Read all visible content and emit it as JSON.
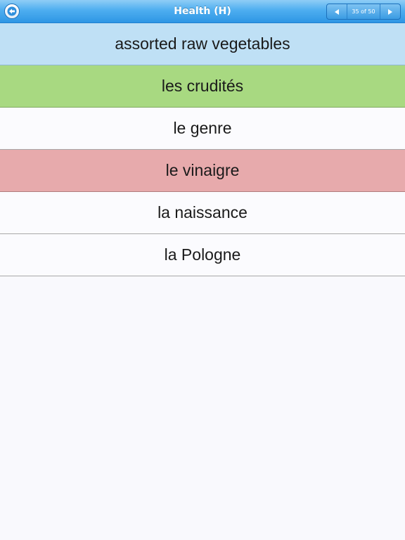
{
  "navbar": {
    "title": "Health (H)",
    "back_icon": "back-arrow-icon",
    "pager": {
      "count": "35 of 50",
      "prev_icon": "triangle-left-icon",
      "next_icon": "triangle-right-icon"
    }
  },
  "question": "assorted raw vegetables",
  "answers": [
    {
      "text": "les crudités",
      "state": "correct"
    },
    {
      "text": "le genre",
      "state": "neutral"
    },
    {
      "text": "le vinaigre",
      "state": "wrong"
    },
    {
      "text": "la naissance",
      "state": "neutral"
    },
    {
      "text": "la Pologne",
      "state": "neutral"
    }
  ],
  "colors": {
    "question_bg": "#bfe0f5",
    "correct_bg": "#a8d981",
    "wrong_bg": "#e7aaac",
    "navbar": "#4eaef0"
  }
}
